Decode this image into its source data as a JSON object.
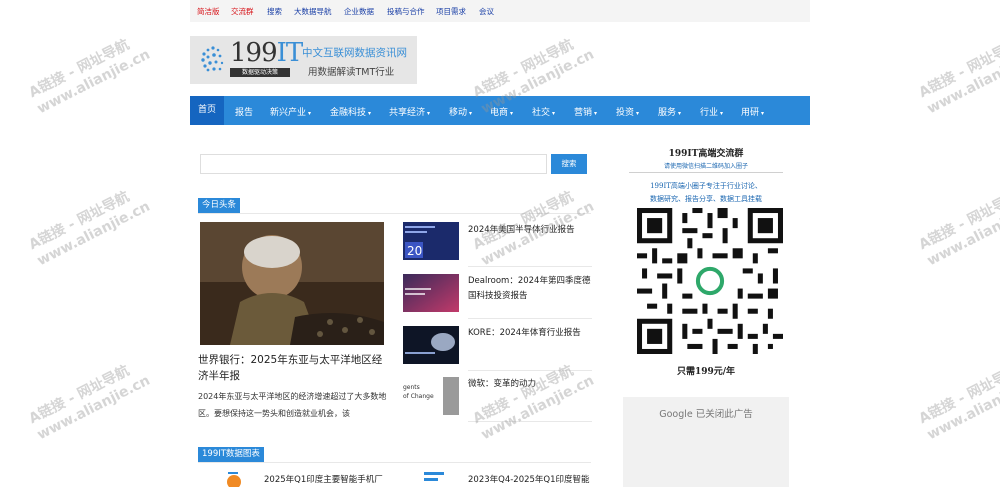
{
  "top_links": [
    {
      "label": "简洁版",
      "red": true
    },
    {
      "label": "交流群",
      "red": true
    },
    {
      "label": "搜索",
      "red": false
    },
    {
      "label": "大数据导航",
      "red": false
    },
    {
      "label": "企业数据",
      "red": false
    },
    {
      "label": "投稿与合作",
      "red": false
    },
    {
      "label": "项目需求",
      "red": false
    },
    {
      "label": "会议",
      "red": false
    }
  ],
  "brand": {
    "logo_num": "199",
    "logo_it": "IT",
    "logo_sub": "数据驱动决策",
    "title": "中文互联网数据资讯网",
    "slogan": "用数据解读TMT行业"
  },
  "nav": [
    {
      "label": "首页",
      "caret": false
    },
    {
      "label": "报告",
      "caret": false
    },
    {
      "label": "新兴产业",
      "caret": true
    },
    {
      "label": "金融科技",
      "caret": true
    },
    {
      "label": "共享经济",
      "caret": true
    },
    {
      "label": "移动",
      "caret": true
    },
    {
      "label": "电商",
      "caret": true
    },
    {
      "label": "社交",
      "caret": true
    },
    {
      "label": "营销",
      "caret": true
    },
    {
      "label": "投资",
      "caret": true
    },
    {
      "label": "服务",
      "caret": true
    },
    {
      "label": "行业",
      "caret": true
    },
    {
      "label": "用研",
      "caret": true
    }
  ],
  "search": {
    "placeholder": "",
    "button": "搜索"
  },
  "headline": {
    "tag": "今日头条",
    "hero_title": "世界银行：2025年东亚与太平洋地区经济半年报",
    "hero_summary": "2024年东亚与太平洋地区的经济增速超过了大多数地区。要想保持这一势头和创造就业机会，该"
  },
  "news": [
    {
      "title": "2024年美国半导体行业报告",
      "thumb_text": "20"
    },
    {
      "title": "Dealroom：2024年第四季度德国科技投资报告",
      "thumb_text": ""
    },
    {
      "title": "KORE：2024年体育行业报告",
      "thumb_text": ""
    },
    {
      "title": "微软：变革的动力",
      "thumb_text": "gents\nof Change"
    }
  ],
  "chart_section": {
    "tag": "199IT数据图表",
    "items": [
      "2025年Q1印度主要智能手机厂",
      "2023年Q4-2025年Q1印度智能"
    ]
  },
  "sidebar": {
    "title": "199IT高端交流群",
    "subtitle": "请使用微信扫描二维码加入圈子",
    "desc1": "199IT高端小圈子专注于行业讨论、",
    "desc2": "数据研究、报告分享、数据工具挂载",
    "price": "只需199元/年"
  },
  "ad": {
    "label": "Google 已关闭此广告"
  },
  "watermark": {
    "line1": "A链接 - 网址导航",
    "line2": "www.alianjie.cn"
  },
  "colors": {
    "brand_blue": "#2b89d9",
    "link_red": "#d7141a",
    "link_blue": "#1a3fa6"
  }
}
